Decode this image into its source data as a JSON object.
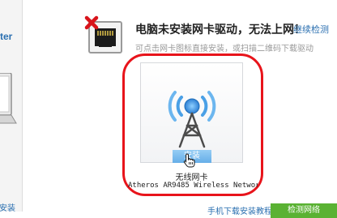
{
  "sidebar": {
    "partial_title": "ter",
    "partial_install": "安装"
  },
  "header": {
    "title": "电脑未安装网卡驱动，无法上网！",
    "retry_link": "继续检测",
    "subtitle": "可点击网卡图标直接安装，或扫描二维码下载驱动"
  },
  "adapter": {
    "install_label": "安装",
    "name": "无线网卡",
    "model": "Atheros AR9485 Wireless Networ..."
  },
  "footer": {
    "manual_download": "手机下载安装教程",
    "detect_button": "检测网络"
  },
  "colors": {
    "highlight": "#e8141b",
    "link": "#2a6fb0",
    "green_button": "#5ab233"
  }
}
